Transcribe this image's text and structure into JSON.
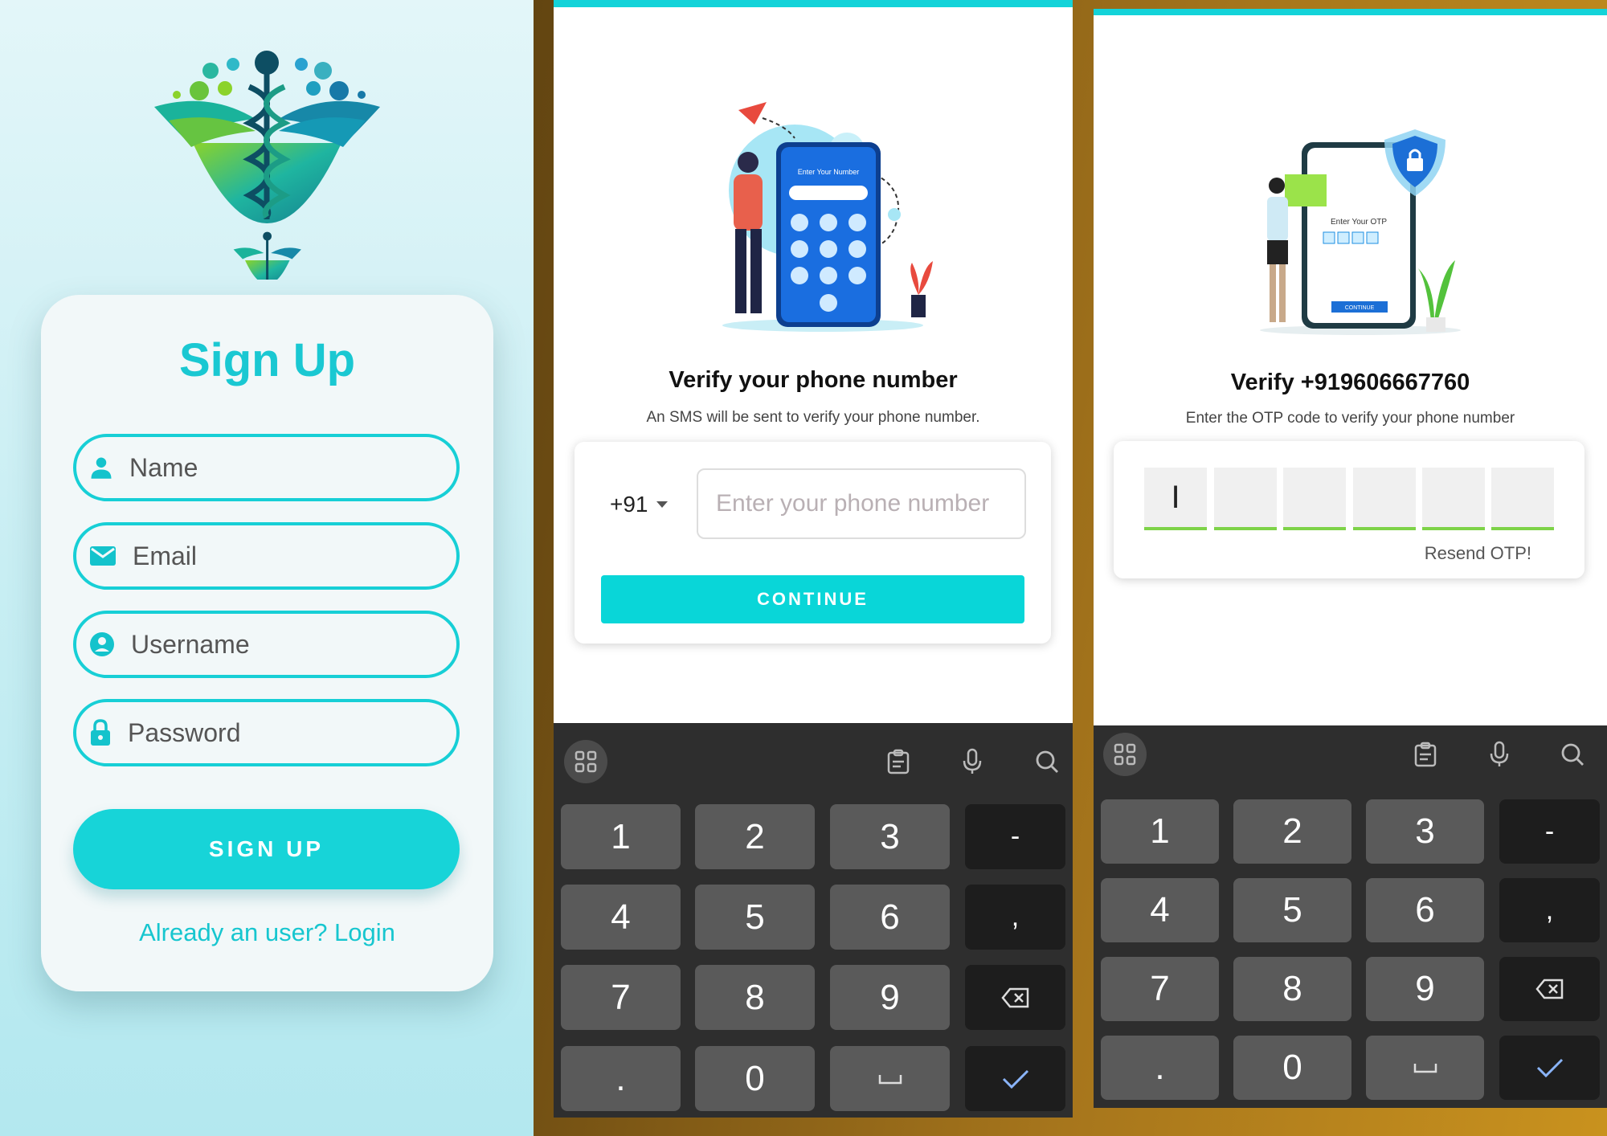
{
  "signup_screen": {
    "title": "Sign Up",
    "fields": {
      "name_placeholder": "Name",
      "email_placeholder": "Email",
      "username_placeholder": "Username",
      "password_placeholder": "Password"
    },
    "submit_label": "SIGN UP",
    "login_link": "Already an user? Login",
    "colors": {
      "accent": "#17d4d8",
      "title": "#1ac8d2",
      "card": "#f2f8f9"
    }
  },
  "phone_screen": {
    "illustration_label": "Enter Your Number",
    "title": "Verify your phone number",
    "subtitle": "An SMS will be sent to verify your phone number.",
    "country_code": "+91",
    "phone_placeholder": "Enter your phone number",
    "continue_label": "CONTINUE"
  },
  "otp_screen": {
    "illustration_label": "Enter Your OTP",
    "illustration_button": "CONTINUE",
    "title": "Verify +919606667760",
    "subtitle": "Enter the OTP code to verify your phone number",
    "otp_boxes": [
      "I",
      "",
      "",
      "",
      "",
      ""
    ],
    "resend_label": "Resend OTP!"
  },
  "keyboard": {
    "toolbar_icons": [
      "grid-icon",
      "clipboard-icon",
      "microphone-icon",
      "search-icon"
    ],
    "keys": [
      "1",
      "2",
      "3",
      "-",
      "4",
      "5",
      "6",
      ",",
      "7",
      "8",
      "9",
      "backspace",
      ".",
      "0",
      "space",
      "check"
    ]
  }
}
